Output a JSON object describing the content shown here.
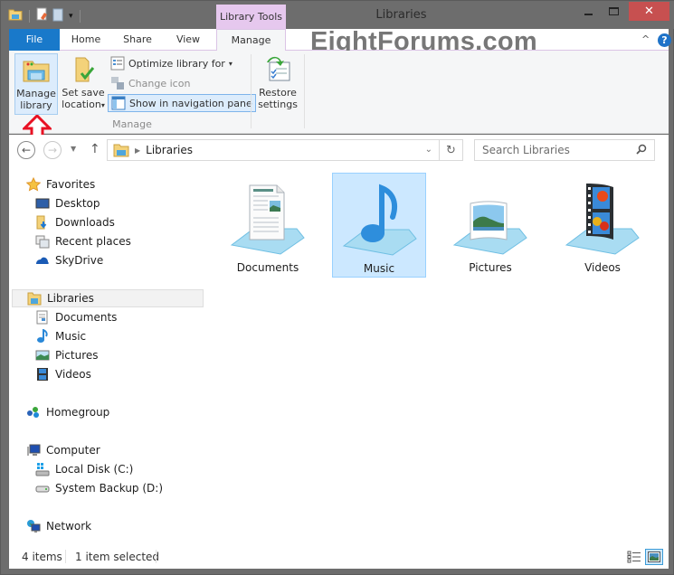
{
  "window": {
    "title": "Libraries",
    "context_tab_group": "Library Tools",
    "controls": {
      "minimize": "‒",
      "maximize": "☐",
      "close": "✕"
    }
  },
  "quick_access": [
    "folder-icon",
    "properties-icon",
    "new-folder-icon",
    "customize-dropdown-icon"
  ],
  "ribbon": {
    "tabs": [
      {
        "label": "File",
        "active": false
      },
      {
        "label": "Home",
        "active": false
      },
      {
        "label": "Share",
        "active": false
      },
      {
        "label": "View",
        "active": false
      },
      {
        "label": "Manage",
        "active": true
      }
    ],
    "watermark": "EightForums.com",
    "collapse_glyph": "^",
    "help_glyph": "?",
    "manage_group": {
      "label": "Manage",
      "manage_library": {
        "line1": "Manage",
        "line2": "library"
      },
      "set_save_location": {
        "line1": "Set save",
        "line2": "location",
        "caret": "▾"
      },
      "optimize_library_for": {
        "label": "Optimize library for",
        "caret": "▾"
      },
      "change_icon": {
        "label": "Change icon",
        "enabled": false
      },
      "show_in_navigation_pane": {
        "label": "Show in navigation pane",
        "checked": true
      }
    },
    "restore_settings": {
      "line1": "Restore",
      "line2": "settings"
    }
  },
  "navbar": {
    "back": "←",
    "forward": "→",
    "recent": "▼",
    "up": "↑",
    "breadcrumb": [
      "Libraries"
    ],
    "breadcrumb_sep": "▶",
    "dropdown": "⌄",
    "refresh": "↻",
    "search_placeholder": "Search Libraries",
    "search_icon": "⚲"
  },
  "nav_pane": {
    "favorites": {
      "label": "Favorites",
      "items": [
        "Desktop",
        "Downloads",
        "Recent places",
        "SkyDrive"
      ]
    },
    "libraries": {
      "label": "Libraries",
      "items": [
        "Documents",
        "Music",
        "Pictures",
        "Videos"
      ]
    },
    "homegroup": {
      "label": "Homegroup"
    },
    "computer": {
      "label": "Computer",
      "items": [
        "Local Disk (C:)",
        "System Backup (D:)"
      ]
    },
    "network": {
      "label": "Network"
    }
  },
  "files": [
    {
      "name": "Documents",
      "selected": false
    },
    {
      "name": "Music",
      "selected": true
    },
    {
      "name": "Pictures",
      "selected": false
    },
    {
      "name": "Videos",
      "selected": false
    }
  ],
  "status": {
    "item_count": "4 items",
    "selection": "1 item selected",
    "view_mode": "large-icons"
  },
  "colors": {
    "file_tab": "#1979ca",
    "context_tab": "#e6c8ee",
    "selection": "#cce8ff",
    "close_button": "#c75050",
    "annotation_arrow": "#e81123"
  }
}
